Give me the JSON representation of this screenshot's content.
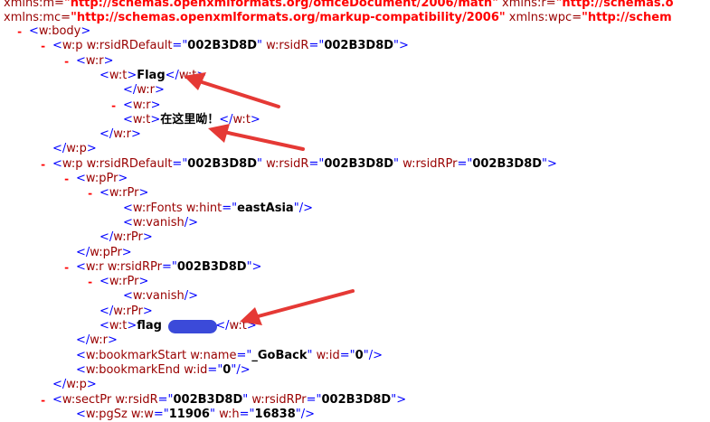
{
  "colors": {
    "tag": "#990000",
    "punct": "#0000ff",
    "value": "#000000",
    "toggle": "#ff0000",
    "arrow": "#e53935",
    "redaction": "#3b4ad9"
  },
  "xml_view": {
    "toggle": "-",
    "ns_line_1": {
      "items": [
        {
          "attr": "xmlns:m=",
          "val": "\"http://schemas.openxmlformats.org/officeDocument/2006/math\""
        },
        {
          "attr": " xmlns:r=",
          "val": "\"http://schemas.o"
        }
      ]
    },
    "ns_line_2": {
      "items": [
        {
          "attr": "xmlns:mc=",
          "val": "\"http://schemas.openxmlformats.org/markup-compatibility/2006\""
        },
        {
          "attr": " xmlns:wpc=",
          "val": "\"http://schem"
        }
      ]
    },
    "lines": [
      {
        "toggle": true,
        "tag": "w:body"
      },
      {
        "toggle": true,
        "tag": "w:p",
        "attrs": [
          [
            "w:rsidRDefault",
            "002B3D8D"
          ],
          [
            "w:rsidR",
            "002B3D8D"
          ]
        ]
      },
      {
        "toggle": true,
        "tag": "w:r"
      },
      {
        "tag": "w:t",
        "text": "Flag",
        "close": "w:t"
      },
      {
        "close": "w:r"
      },
      {
        "toggle": true,
        "tag": "w:r"
      },
      {
        "tag": "w:t",
        "text": "在这里呦！",
        "close": "w:t"
      },
      {
        "close": "w:r"
      },
      {
        "close": "w:p"
      },
      {
        "toggle": true,
        "tag": "w:p",
        "attrs": [
          [
            "w:rsidRDefault",
            "002B3D8D"
          ],
          [
            "w:rsidR",
            "002B3D8D"
          ],
          [
            "w:rsidRPr",
            "002B3D8D"
          ]
        ]
      },
      {
        "toggle": true,
        "tag": "w:pPr"
      },
      {
        "toggle": true,
        "tag": "w:rPr"
      },
      {
        "tag": "w:rFonts",
        "attrs": [
          [
            "w:hint",
            "eastAsia"
          ]
        ],
        "selfclose": true
      },
      {
        "tag": "w:vanish",
        "selfclose": true
      },
      {
        "close": "w:rPr"
      },
      {
        "close": "w:pPr"
      },
      {
        "toggle": true,
        "tag": "w:r",
        "attrs": [
          [
            "w:rsidRPr",
            "002B3D8D"
          ]
        ]
      },
      {
        "toggle": true,
        "tag": "w:rPr"
      },
      {
        "tag": "w:vanish",
        "selfclose": true
      },
      {
        "close": "w:rPr"
      },
      {
        "tag": "w:t",
        "text": "flag",
        "text_tail": "}",
        "close": "w:t"
      },
      {
        "close": "w:r"
      },
      {
        "tag": "w:bookmarkStart",
        "attrs": [
          [
            "w:name",
            "_GoBack"
          ],
          [
            "w:id",
            "0"
          ]
        ],
        "selfclose": true
      },
      {
        "tag": "w:bookmarkEnd",
        "attrs": [
          [
            "w:id",
            "0"
          ]
        ],
        "selfclose": true
      },
      {
        "close": "w:p"
      },
      {
        "toggle": true,
        "tag": "w:sectPr",
        "attrs": [
          [
            "w:rsidR",
            "002B3D8D"
          ],
          [
            "w:rsidRPr",
            "002B3D8D"
          ]
        ]
      },
      {
        "tag": "w:pgSz",
        "attrs": [
          [
            "w:w",
            "11906"
          ],
          [
            "w:h",
            "16838"
          ]
        ],
        "selfclose": true
      }
    ]
  }
}
